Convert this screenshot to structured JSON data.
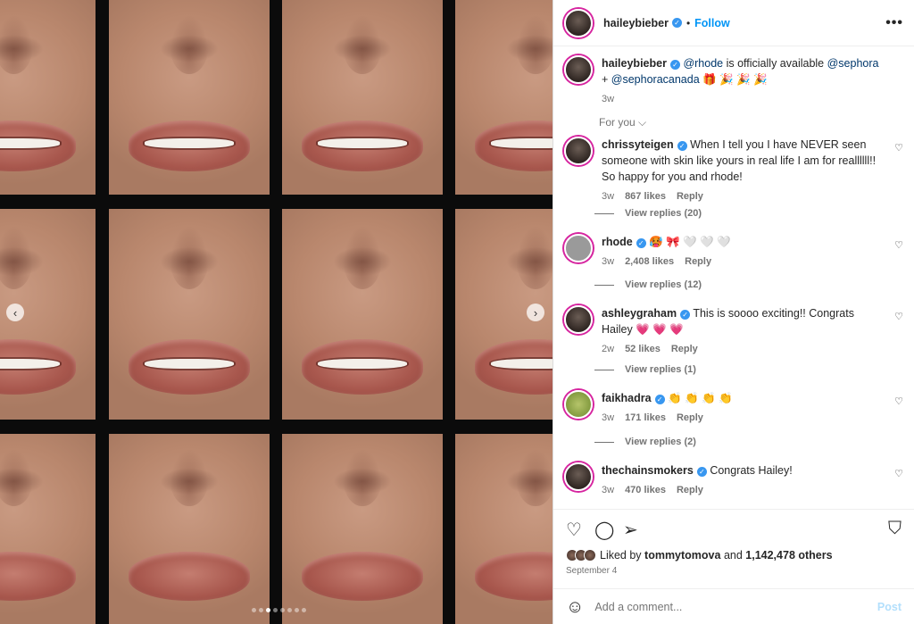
{
  "header": {
    "username": "haileybieber",
    "separator": "•",
    "follow_label": "Follow",
    "more_label": "•••"
  },
  "caption": {
    "username": "haileybieber",
    "mention1": "@rhode",
    "text1": " is officially available ",
    "mention2": "@sephora",
    "text2": " + ",
    "mention3": "@sephoracanada",
    "emojis": " 🎁 🎉 🎉 🎉",
    "time": "3w"
  },
  "for_you_label": "For you ⌵",
  "comments": [
    {
      "username": "chrissyteigen",
      "text": "When I tell you I have NEVER seen someone with skin like yours in real life I am for reallllll!! So happy for you and rhode!",
      "time": "3w",
      "likes": "867 likes",
      "reply": "Reply",
      "view_replies": "View replies (20)"
    },
    {
      "username": "rhode",
      "text": "🥵 🎀 🤍 🤍 🤍",
      "time": "3w",
      "likes": "2,408 likes",
      "reply": "Reply",
      "view_replies": "View replies (12)"
    },
    {
      "username": "ashleygraham",
      "text": "This is soooo exciting!! Congrats Hailey 💗 💗 💗",
      "time": "2w",
      "likes": "52 likes",
      "reply": "Reply",
      "view_replies": "View replies (1)"
    },
    {
      "username": "faikhadra",
      "text": "👏 👏 👏 👏",
      "time": "3w",
      "likes": "171 likes",
      "reply": "Reply",
      "view_replies": "View replies (2)"
    },
    {
      "username": "thechainsmokers",
      "text": "Congrats Hailey!",
      "time": "3w",
      "likes": "470 likes",
      "reply": "Reply"
    }
  ],
  "likes": {
    "prefix": "Liked by ",
    "user": "tommytomova",
    "middle": " and ",
    "count": "1,142,478 others"
  },
  "date": "September 4",
  "add_comment": {
    "placeholder": "Add a comment...",
    "post_label": "Post"
  },
  "icons": {
    "heart": "heart-icon",
    "comment": "comment-icon",
    "share": "share-icon",
    "save": "bookmark-icon",
    "emoji": "emoji-icon"
  },
  "carousel": {
    "total": 8,
    "active": 2
  }
}
